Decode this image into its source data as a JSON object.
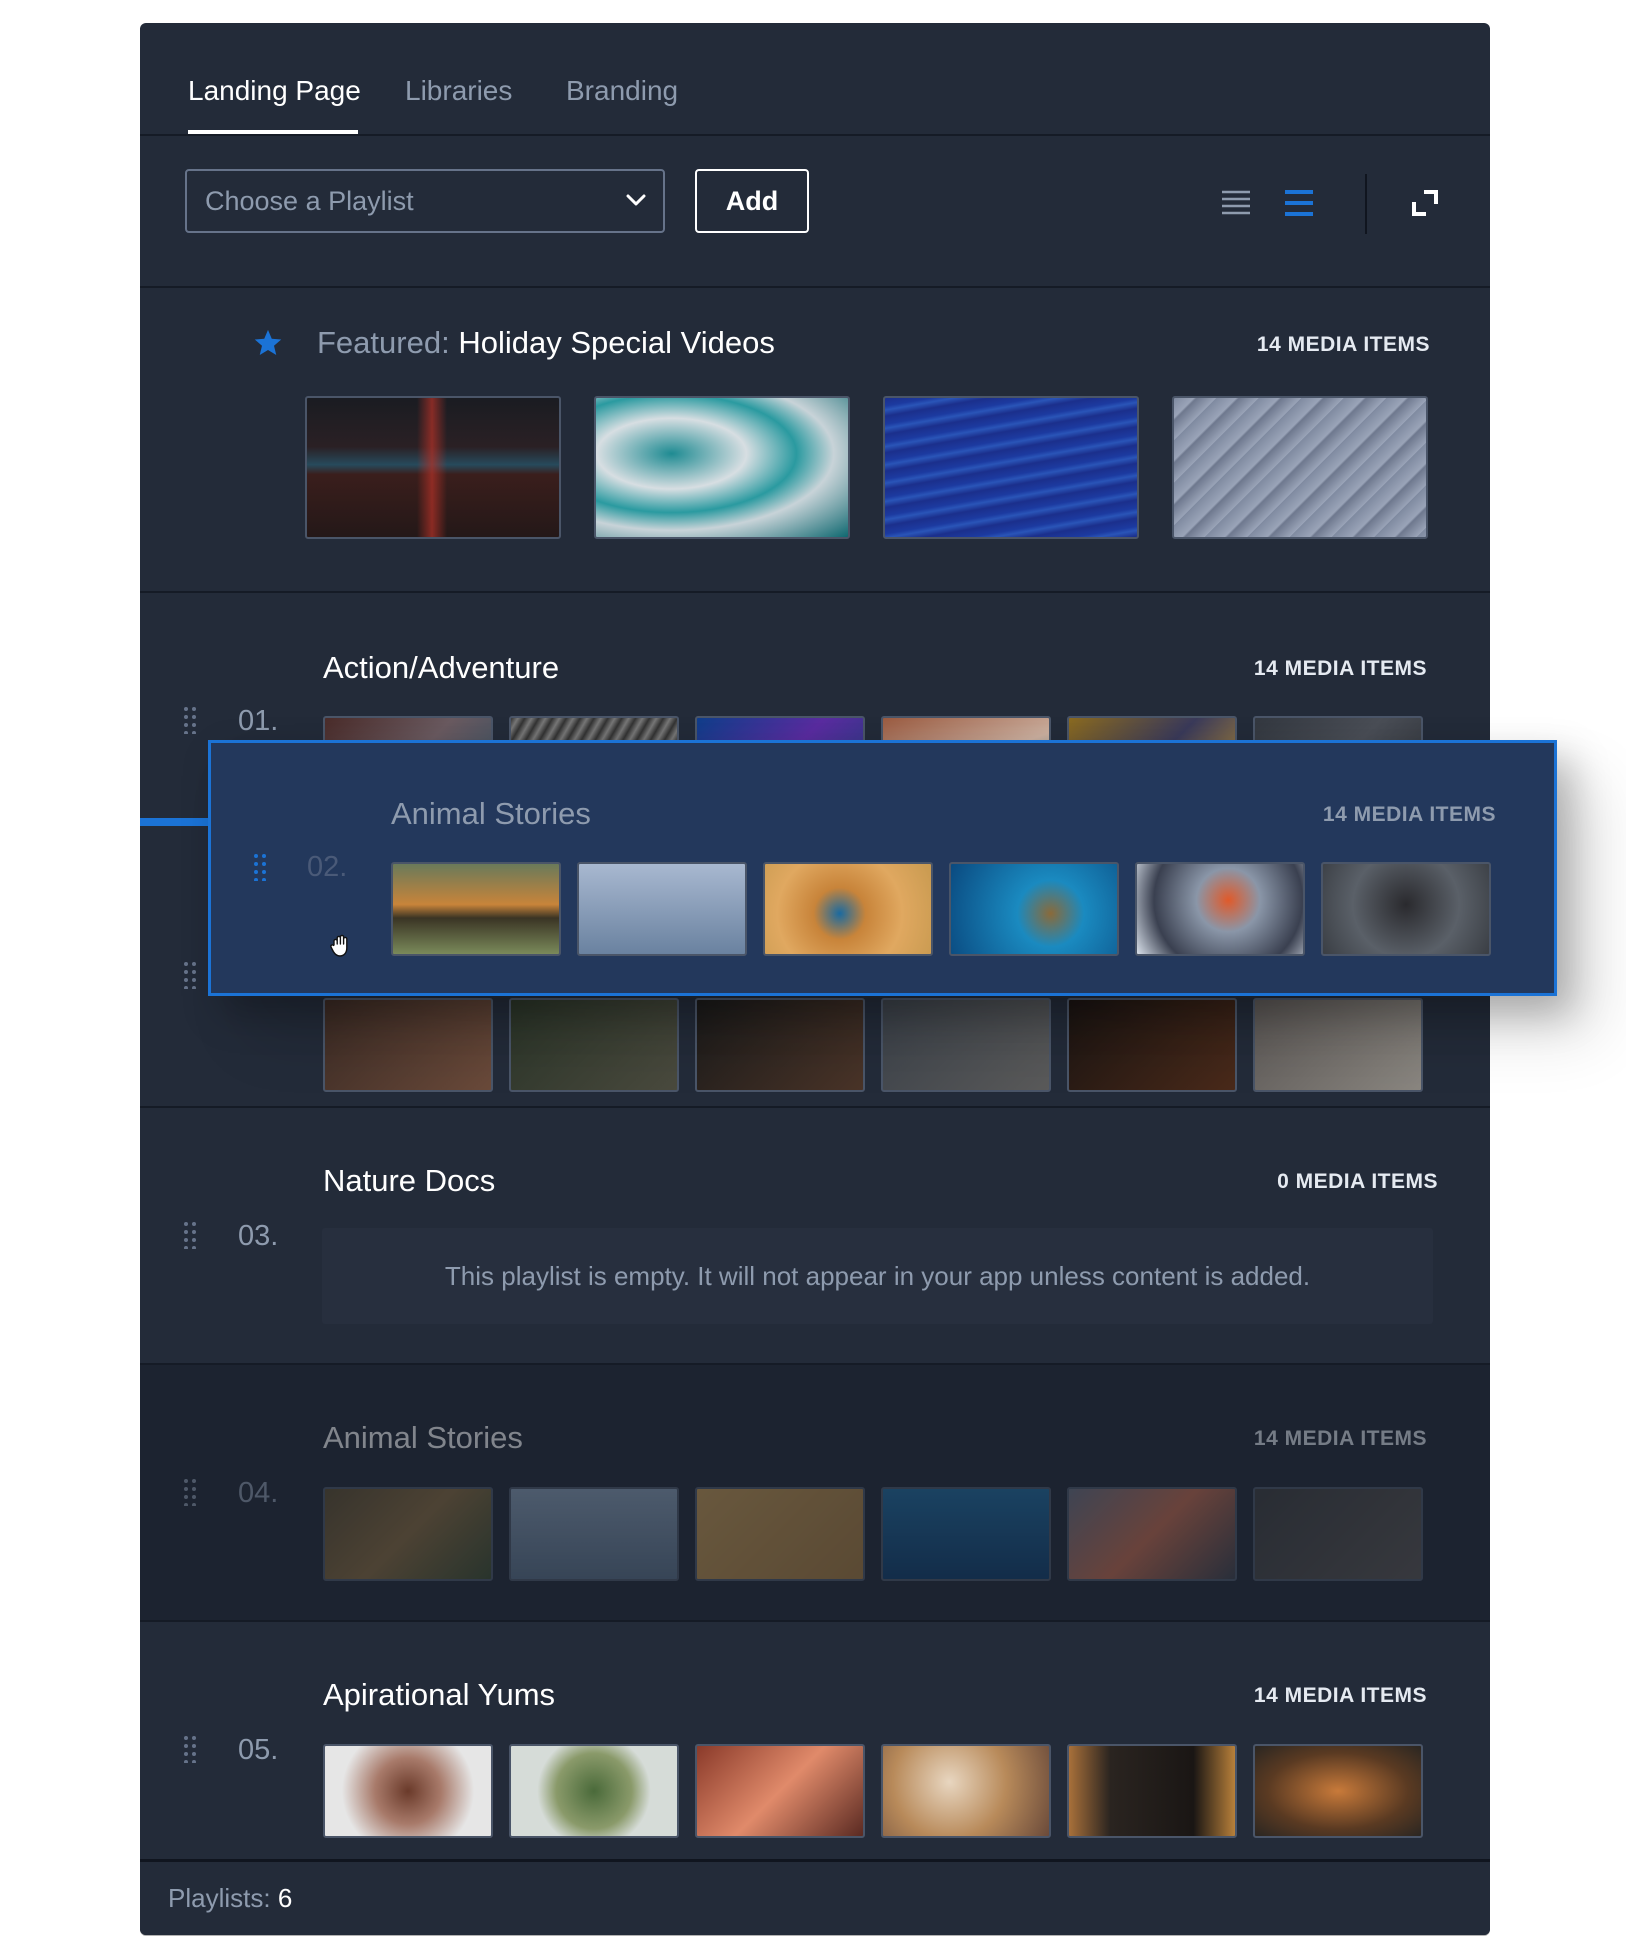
{
  "tabs": [
    {
      "label": "Landing Page",
      "active": true
    },
    {
      "label": "Libraries",
      "active": false
    },
    {
      "label": "Branding",
      "active": false
    }
  ],
  "toolbar": {
    "playlist_placeholder": "Choose a Playlist",
    "add_label": "Add",
    "icons": [
      "list-compact-icon",
      "list-expanded-icon",
      "expand-icon"
    ]
  },
  "featured": {
    "prefix": "Featured:",
    "title": "Holiday Special Videos",
    "count": "14 MEDIA ITEMS",
    "thumbs": [
      "red-abstract",
      "teal-marble",
      "blue-waves",
      "grey-arches"
    ]
  },
  "playlists": [
    {
      "num": "01.",
      "title": "Action/Adventure",
      "count": "14 MEDIA ITEMS"
    },
    {
      "num": "02.",
      "title": "Animal Stories",
      "count": "14 MEDIA ITEMS",
      "dragging": true
    },
    {
      "num": "03.",
      "title": "Nature Docs",
      "count": "0 MEDIA ITEMS",
      "empty_message": "This playlist is empty. It will not appear in your app unless content is added."
    },
    {
      "num": "04.",
      "title": "Animal Stories",
      "count": "14 MEDIA ITEMS"
    },
    {
      "num": "05.",
      "title": "Apirational Yums",
      "count": "14 MEDIA ITEMS"
    }
  ],
  "footer": {
    "label": "Playlists:",
    "value": "6"
  },
  "colors": {
    "accent": "#1b73d6",
    "background": "#232b39",
    "drag_card": "#23385c"
  }
}
